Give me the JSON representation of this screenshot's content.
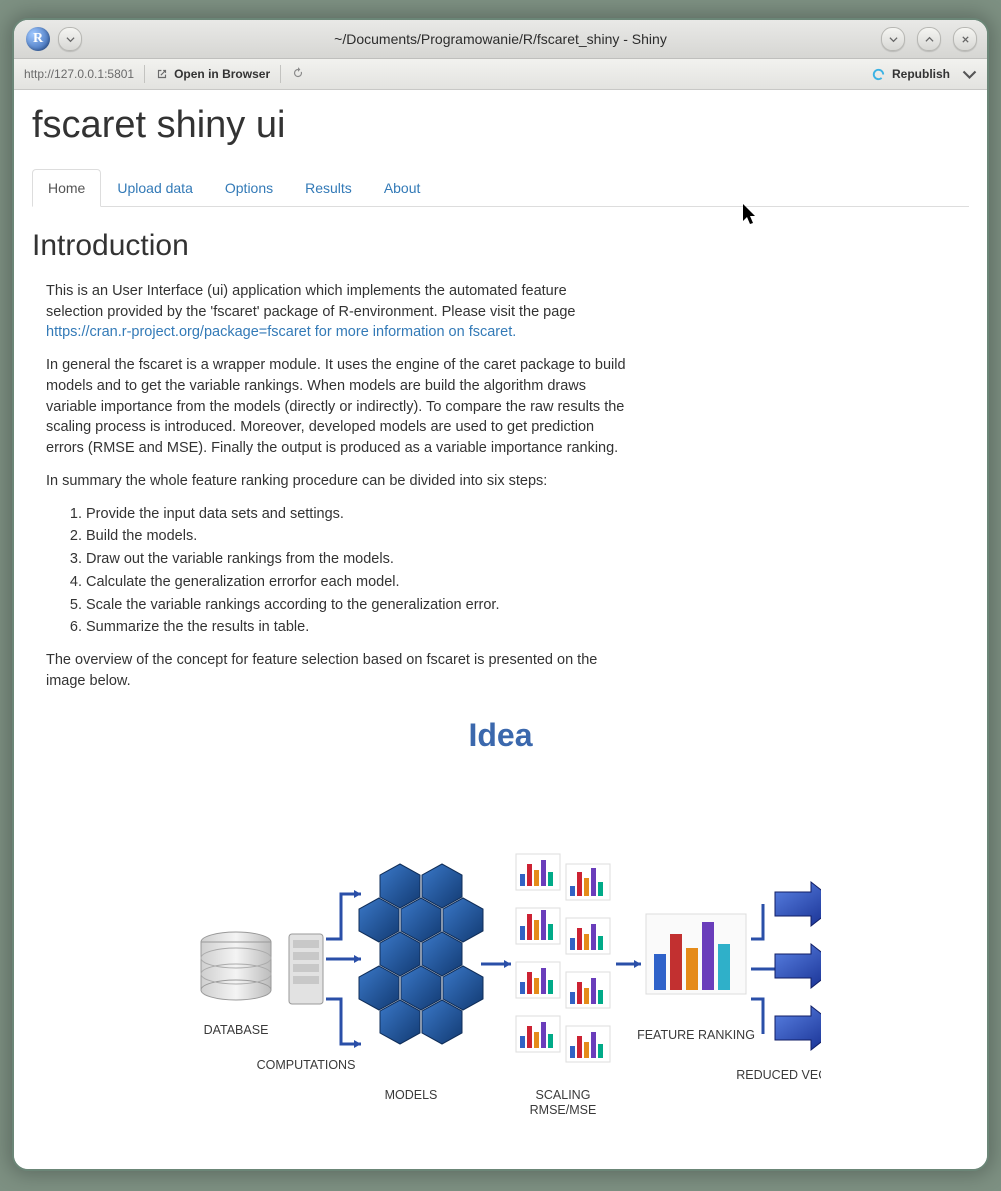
{
  "window": {
    "title": "~/Documents/Programowanie/R/fscaret_shiny - Shiny"
  },
  "toolbar": {
    "url": "http://127.0.0.1:5801",
    "open_browser": "Open in Browser",
    "republish": "Republish"
  },
  "page": {
    "title": "fscaret shiny ui",
    "tabs": [
      "Home",
      "Upload data",
      "Options",
      "Results",
      "About"
    ],
    "active_tab": 0,
    "h2": "Introduction",
    "p1": "This is an User Interface (ui) application which implements the automated feature selection provided by the 'fscaret' package of R-environment. Please visit the page ",
    "link": "https://cran.r-project.org/package=fscaret for more information on fscaret.",
    "p2": "In general the fscaret is a wrapper module. It uses the engine of the caret package to build models and to get the variable rankings. When models are build the algorithm draws variable importance from the models (directly or indirectly). To compare the raw results the scaling process is introduced. Moreover, developed models are used to get prediction errors (RMSE and MSE). Finally the output is produced as a variable importance ranking.",
    "p3": "In summary the whole feature ranking procedure can be divided into six steps:",
    "steps": [
      "Provide the input data sets and settings.",
      "Build the models.",
      "Draw out the variable rankings from the models.",
      "Calculate the generalization errorfor each model.",
      "Scale the variable rankings according to the generalization error.",
      "Summarize the the results in table."
    ],
    "p4": "The overview of the concept for feature selection based on fscaret is presented on the image below."
  },
  "diagram": {
    "title": "Idea",
    "labels": {
      "database": "DATABASE",
      "computations": "COMPUTATIONS",
      "models": "MODELS",
      "scaling": "SCALING\nRMSE/MSE",
      "feature_ranking": "FEATURE RANKING",
      "reduced_vectors": "REDUCED VECTORS"
    }
  }
}
